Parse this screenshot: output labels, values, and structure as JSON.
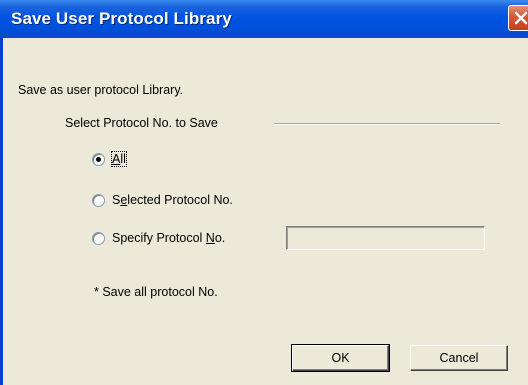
{
  "window": {
    "title": "Save User Protocol Library"
  },
  "dialog": {
    "description": "Save as user protocol Library.",
    "group_label": "Select Protocol No. to Save",
    "options": [
      {
        "label_pre": "",
        "mnemonic": "A",
        "label_post": "ll",
        "checked": true
      },
      {
        "label_pre": "S",
        "mnemonic": "e",
        "label_post": "lected Protocol No.",
        "checked": false
      },
      {
        "label_pre": "Specify Protocol ",
        "mnemonic": "N",
        "label_post": "o.",
        "checked": false
      }
    ],
    "protocol_no_field": {
      "value": "",
      "enabled": false
    },
    "note": "* Save all protocol No."
  },
  "buttons": {
    "ok_label": "OK",
    "cancel_label": "Cancel"
  }
}
